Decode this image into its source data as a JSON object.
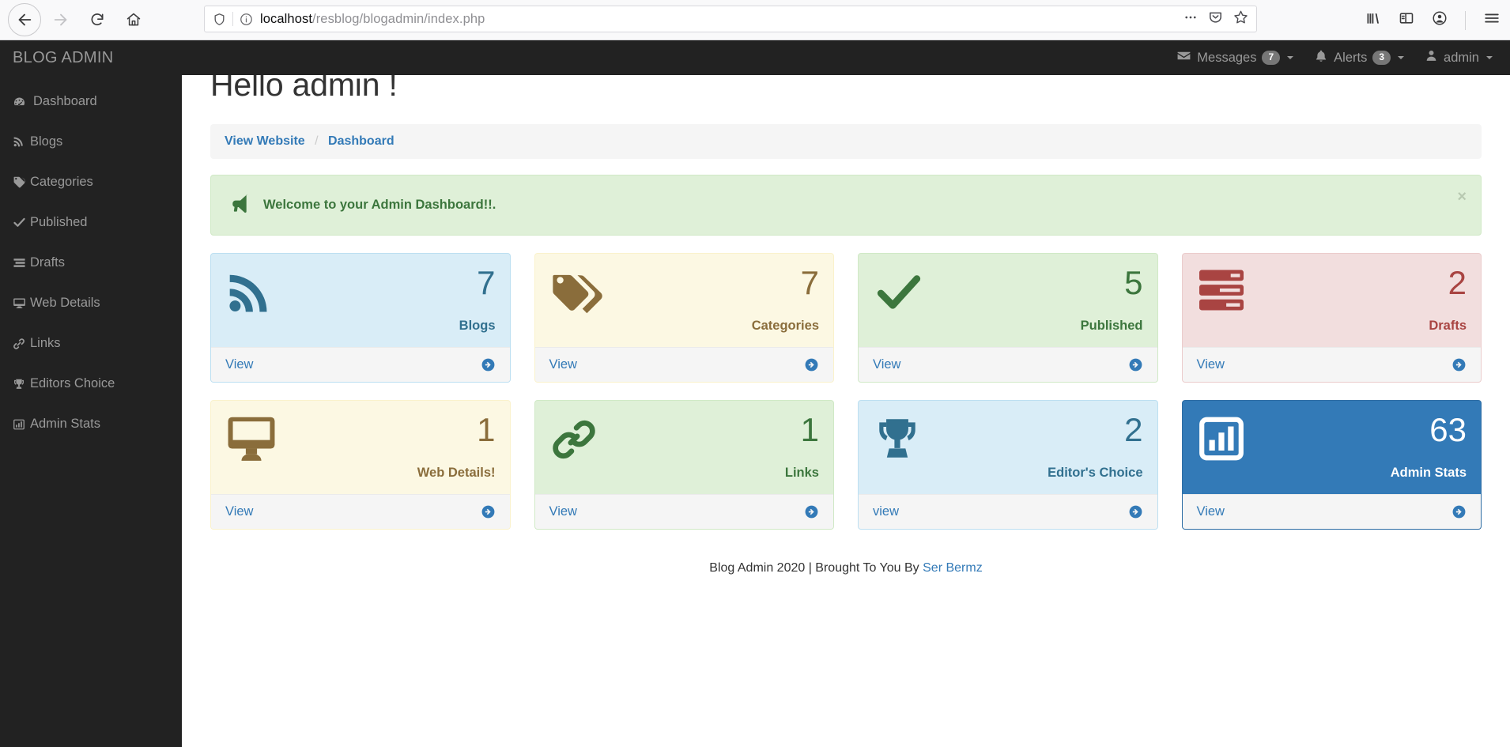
{
  "browser": {
    "url_host": "localhost",
    "url_path": "/resblog/blogadmin/index.php",
    "back_icon": "back-arrow-icon",
    "forward_icon": "forward-arrow-icon",
    "reload_icon": "reload-icon",
    "home_icon": "home-icon",
    "shield_icon": "shield-icon",
    "info_icon": "info-circle-icon",
    "page_actions_icon": "ellipsis-icon",
    "pocket_icon": "pocket-icon",
    "bookmark_icon": "star-icon",
    "library_icon": "library-icon",
    "sidebar_icon": "sidebar-toggle-icon",
    "account_icon": "account-icon",
    "menu_icon": "hamburger-menu-icon"
  },
  "topnav": {
    "brand": "BLOG ADMIN",
    "messages": {
      "label": "Messages",
      "badge": "7",
      "icon": "envelope-icon"
    },
    "alerts": {
      "label": "Alerts",
      "badge": "3",
      "icon": "bell-icon"
    },
    "user": {
      "label": "admin",
      "icon": "user-icon"
    }
  },
  "sidebar": {
    "items": [
      {
        "label": "Dashboard",
        "icon": "tachometer-icon"
      },
      {
        "label": "Blogs",
        "icon": "rss-icon"
      },
      {
        "label": "Categories",
        "icon": "tag-icon"
      },
      {
        "label": "Published",
        "icon": "check-icon"
      },
      {
        "label": "Drafts",
        "icon": "list-icon"
      },
      {
        "label": "Web Details",
        "icon": "desktop-icon"
      },
      {
        "label": "Links",
        "icon": "link-icon"
      },
      {
        "label": "Editors Choice",
        "icon": "trophy-icon"
      },
      {
        "label": "Admin Stats",
        "icon": "bar-chart-icon"
      }
    ]
  },
  "main": {
    "page_title": "Hello admin !",
    "breadcrumb": {
      "first": "View Website",
      "separator": "/",
      "second": "Dashboard"
    },
    "alert": {
      "icon": "bullhorn-icon",
      "message": "Welcome to your Admin Dashboard!!.",
      "close_label": "×"
    },
    "cards": [
      {
        "count": "7",
        "label": "Blogs",
        "link": "View",
        "icon": "rss-icon",
        "palette": "pal-info"
      },
      {
        "count": "7",
        "label": "Categories",
        "link": "View",
        "icon": "tags-icon",
        "palette": "pal-warning"
      },
      {
        "count": "5",
        "label": "Published",
        "link": "View",
        "icon": "check-icon",
        "palette": "pal-success"
      },
      {
        "count": "2",
        "label": "Drafts",
        "link": "View",
        "icon": "server-icon",
        "palette": "pal-danger"
      },
      {
        "count": "1",
        "label": "Web Details!",
        "link": "View",
        "icon": "desktop-icon",
        "palette": "pal-warning"
      },
      {
        "count": "1",
        "label": "Links",
        "link": "View",
        "icon": "chain-icon",
        "palette": "pal-success"
      },
      {
        "count": "2",
        "label": "Editor's Choice",
        "link": "view",
        "icon": "trophy-icon",
        "palette": "pal-info"
      },
      {
        "count": "63",
        "label": "Admin Stats",
        "link": "View",
        "icon": "bar-chart-icon",
        "palette": "pal-primary"
      }
    ]
  },
  "footer": {
    "text": "Blog Admin 2020 | Brought To You By",
    "author": "Ser Bermz"
  },
  "colors": {
    "sidebar_bg": "#222222",
    "link": "#337ab7",
    "info": "#31708f",
    "warning": "#8a6d3b",
    "success": "#3c763d",
    "danger": "#a94442",
    "primary": "#337ab7"
  }
}
